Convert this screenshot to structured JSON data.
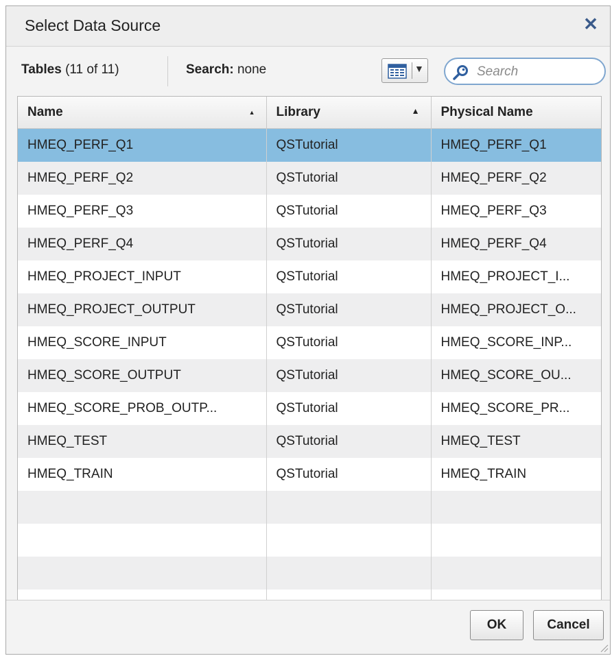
{
  "dialog": {
    "title": "Select Data Source",
    "close_glyph": "✕"
  },
  "info": {
    "tables_label": "Tables",
    "tables_count": "(11 of 11)",
    "search_label": "Search:",
    "search_value": "none"
  },
  "view_menu": {
    "icon": "grid-view-icon",
    "caret": "▼"
  },
  "search": {
    "placeholder": "Search",
    "value": ""
  },
  "table": {
    "columns": [
      {
        "label": "Name",
        "sort": "▲"
      },
      {
        "label": "Library",
        "sort": "▲"
      },
      {
        "label": "Physical Name",
        "sort": ""
      }
    ],
    "rows": [
      [
        "HMEQ_PERF_Q1",
        "QSTutorial",
        "HMEQ_PERF_Q1"
      ],
      [
        "HMEQ_PERF_Q2",
        "QSTutorial",
        "HMEQ_PERF_Q2"
      ],
      [
        "HMEQ_PERF_Q3",
        "QSTutorial",
        "HMEQ_PERF_Q3"
      ],
      [
        "HMEQ_PERF_Q4",
        "QSTutorial",
        "HMEQ_PERF_Q4"
      ],
      [
        "HMEQ_PROJECT_INPUT",
        "QSTutorial",
        "HMEQ_PROJECT_I..."
      ],
      [
        "HMEQ_PROJECT_OUTPUT",
        "QSTutorial",
        "HMEQ_PROJECT_O..."
      ],
      [
        "HMEQ_SCORE_INPUT",
        "QSTutorial",
        "HMEQ_SCORE_INP..."
      ],
      [
        "HMEQ_SCORE_OUTPUT",
        "QSTutorial",
        "HMEQ_SCORE_OU..."
      ],
      [
        "HMEQ_SCORE_PROB_OUTP...",
        "QSTutorial",
        "HMEQ_SCORE_PR..."
      ],
      [
        "HMEQ_TEST",
        "QSTutorial",
        "HMEQ_TEST"
      ],
      [
        "HMEQ_TRAIN",
        "QSTutorial",
        "HMEQ_TRAIN"
      ]
    ]
  },
  "buttons": {
    "ok": "OK",
    "cancel": "Cancel"
  },
  "colors": {
    "selected_row": "#87bde0",
    "accent": "#7fa6cf"
  }
}
